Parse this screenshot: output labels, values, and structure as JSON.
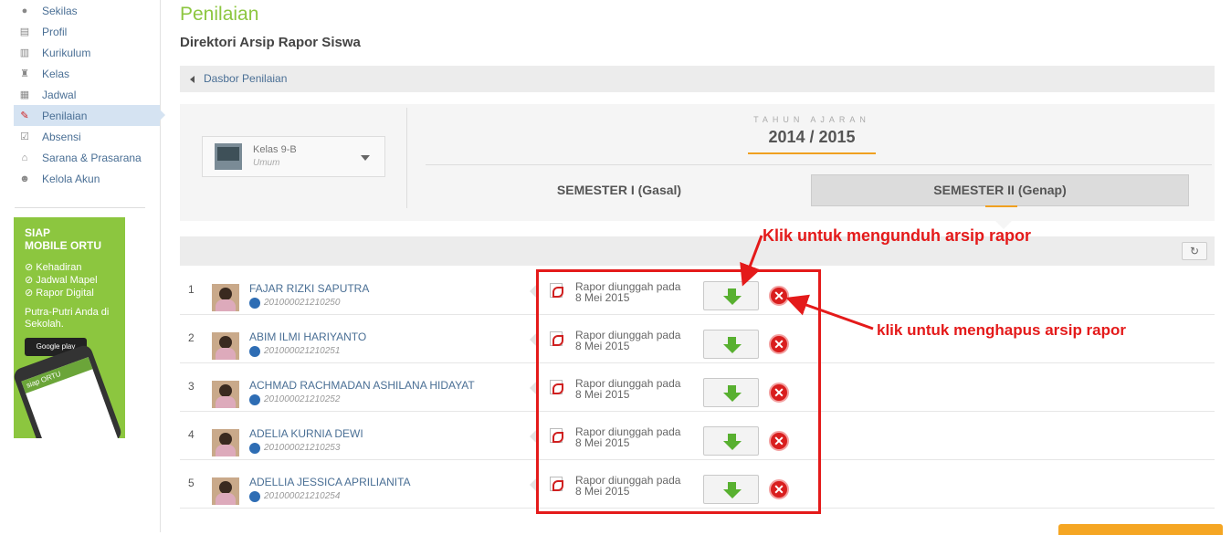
{
  "sidebar": {
    "items": [
      {
        "label": "Sekilas",
        "icon": "info-icon"
      },
      {
        "label": "Profil",
        "icon": "profile-icon"
      },
      {
        "label": "Kurikulum",
        "icon": "curriculum-icon"
      },
      {
        "label": "Kelas",
        "icon": "chair-icon"
      },
      {
        "label": "Jadwal",
        "icon": "schedule-icon"
      },
      {
        "label": "Penilaian",
        "icon": "grading-icon",
        "active": true
      },
      {
        "label": "Absensi",
        "icon": "attendance-icon"
      },
      {
        "label": "Sarana & Prasarana",
        "icon": "facility-icon"
      },
      {
        "label": "Kelola Akun",
        "icon": "users-icon"
      }
    ],
    "ad": {
      "title": "SIAP\nMOBILE ORTU",
      "features": [
        "Kehadiran",
        "Jadwal Mapel",
        "Rapor Digital"
      ],
      "tagline": "Putra-Putri Anda di Sekolah.",
      "store": "Google play",
      "app_bar": "siap ORTU"
    }
  },
  "page": {
    "title": "Penilaian",
    "subtitle": "Direktori Arsip Rapor Siswa",
    "breadcrumb": "Dasbor Penilaian"
  },
  "class_select": {
    "name": "Kelas 9-B",
    "type": "Umum"
  },
  "academic_year": {
    "label": "TAHUN AJARAN",
    "value": "2014 / 2015"
  },
  "semesters": [
    {
      "label": "SEMESTER I (Gasal)",
      "active": false
    },
    {
      "label": "SEMESTER II (Genap)",
      "active": true
    }
  ],
  "students": [
    {
      "no": "1",
      "name": "FAJAR RIZKI SAPUTRA",
      "nis": "201000021210250",
      "status": "Rapor diunggah pada",
      "date": "8 Mei 2015"
    },
    {
      "no": "2",
      "name": "ABIM ILMI HARIYANTO",
      "nis": "201000021210251",
      "status": "Rapor diunggah pada",
      "date": "8 Mei 2015"
    },
    {
      "no": "3",
      "name": "ACHMAD RACHMADAN ASHILANA HIDAYAT",
      "nis": "201000021210252",
      "status": "Rapor diunggah pada",
      "date": "8 Mei 2015"
    },
    {
      "no": "4",
      "name": "ADELIA KURNIA DEWI",
      "nis": "201000021210253",
      "status": "Rapor diunggah pada",
      "date": "8 Mei 2015"
    },
    {
      "no": "5",
      "name": "ADELLIA JESSICA APRILIANITA",
      "nis": "201000021210254",
      "status": "Rapor diunggah pada",
      "date": "8 Mei 2015"
    }
  ],
  "annotations": {
    "download": "Klik untuk mengunduh arsip rapor",
    "delete": "klik untuk menghapus arsip rapor"
  },
  "colors": {
    "accent_green": "#8cc63f",
    "link_blue": "#4a6f95",
    "annotation_red": "#e41a1a",
    "orange": "#f0a020"
  }
}
